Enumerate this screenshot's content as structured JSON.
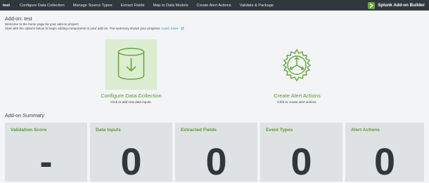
{
  "topbar": {
    "app_name": "test",
    "nav": [
      "Configure Data Collection",
      "Manage Source Types",
      "Extract Fields",
      "Map to Data Models",
      "Create Alert Actions",
      "Validate & Package"
    ],
    "brand": "Splunk Add-on Builder"
  },
  "page": {
    "title": "Add-on: test",
    "intro_line1": "Welcome to the home page for your add-on project!",
    "intro_line2": "Start with the options below to begin adding components to your add-on. The summary shows your progress.",
    "learn_more": "Learn more"
  },
  "actions": {
    "configure": {
      "title": "Configure Data Collection",
      "subtitle": "Click to add new data inputs."
    },
    "alert": {
      "title": "Create Alert Actions",
      "subtitle": "Click to create alert actions."
    }
  },
  "summary": {
    "title": "Add-on Summary",
    "cards": [
      {
        "label": "Validation Score",
        "value": "-"
      },
      {
        "label": "Data Inputs",
        "value": "0"
      },
      {
        "label": "Extracted Fields",
        "value": "0"
      },
      {
        "label": "Event Types",
        "value": "0"
      },
      {
        "label": "Alert Actions",
        "value": "0"
      }
    ]
  },
  "colors": {
    "accent": "#65a637",
    "nav_bg": "#31373e",
    "tile_bg": "#dcedd2",
    "card_bg": "#dfe2e5"
  }
}
